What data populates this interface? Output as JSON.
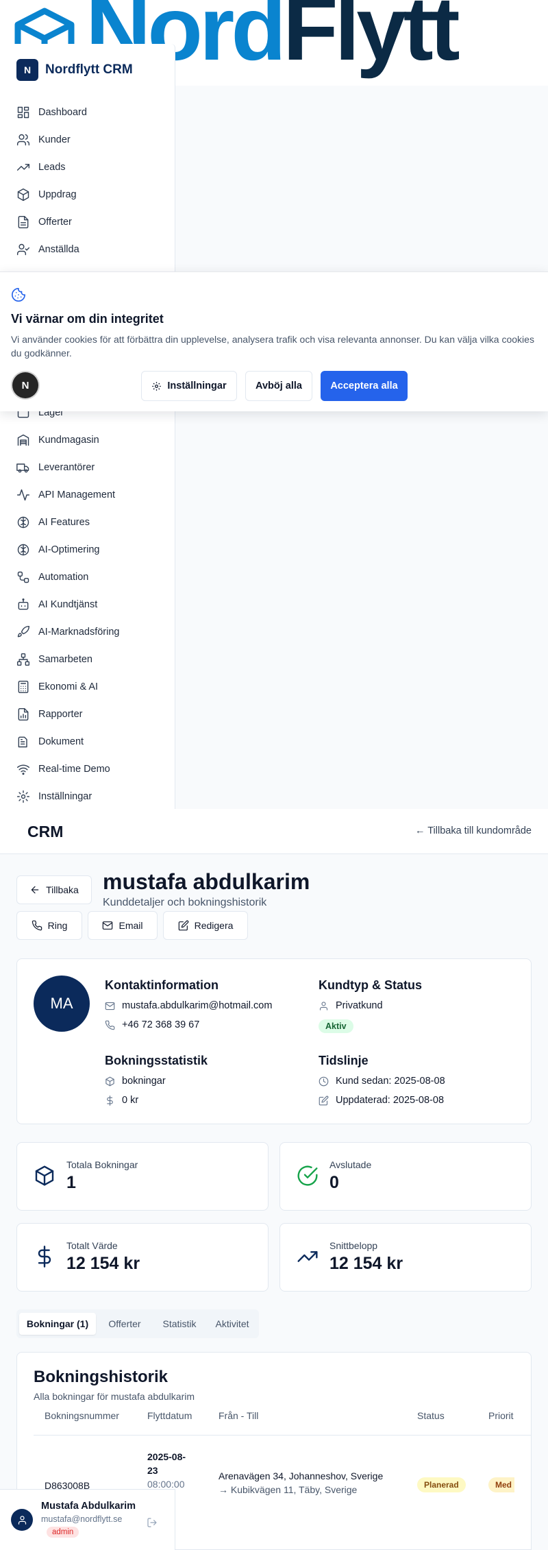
{
  "logo": {
    "part1": "Nord",
    "part2": "Flytt"
  },
  "brand": {
    "badge": "N",
    "name": "Nordflytt CRM"
  },
  "sidebar": {
    "top_items": [
      {
        "label": "Dashboard",
        "icon": "dashboard-icon"
      },
      {
        "label": "Kunder",
        "icon": "users-icon"
      },
      {
        "label": "Leads",
        "icon": "trending-up-icon"
      },
      {
        "label": "Uppdrag",
        "icon": "package-icon"
      },
      {
        "label": "Offerter",
        "icon": "file-text-icon"
      },
      {
        "label": "Anställda",
        "icon": "user-check-icon"
      }
    ],
    "bottom_items": [
      {
        "label": "Lager",
        "icon": "box-icon"
      },
      {
        "label": "Kundmagasin",
        "icon": "warehouse-icon"
      },
      {
        "label": "Leverantörer",
        "icon": "truck-icon"
      },
      {
        "label": "API Management",
        "icon": "activity-icon"
      },
      {
        "label": "AI Features",
        "icon": "brain-icon"
      },
      {
        "label": "AI-Optimering",
        "icon": "brain-icon"
      },
      {
        "label": "Automation",
        "icon": "workflow-icon"
      },
      {
        "label": "AI Kundtjänst",
        "icon": "bot-icon"
      },
      {
        "label": "AI-Marknadsföring",
        "icon": "rocket-icon"
      },
      {
        "label": "Samarbeten",
        "icon": "network-icon"
      },
      {
        "label": "Ekonomi & AI",
        "icon": "calculator-icon"
      },
      {
        "label": "Rapporter",
        "icon": "file-chart-icon"
      },
      {
        "label": "Dokument",
        "icon": "documents-icon"
      },
      {
        "label": "Real-time Demo",
        "icon": "wifi-icon"
      },
      {
        "label": "Inställningar",
        "icon": "settings-icon"
      }
    ]
  },
  "cookie": {
    "title": "Vi värnar om din integritet",
    "text": "Vi använder cookies för att förbättra din upplevelse, analysera trafik och visa relevanta annonser. Du kan välja vilka cookies du godkänner.",
    "avatar": "N",
    "settings_label": "Inställningar",
    "reject_label": "Avböj alla",
    "accept_label": "Acceptera alla"
  },
  "header": {
    "title": "CRM",
    "back_link": "← Tillbaka till kundområde"
  },
  "customer": {
    "back_label": "Tillbaka",
    "name": "mustafa abdulkarim",
    "subtitle": "Kunddetaljer och bokningshistorik",
    "actions": {
      "call": "Ring",
      "email": "Email",
      "edit": "Redigera"
    },
    "initials": "MA",
    "contact_title": "Kontaktinformation",
    "email": "mustafa.abdulkarim@hotmail.com",
    "phone": "+46 72 368 39 67",
    "type_title": "Kundtyp & Status",
    "type": "Privatkund",
    "status": "Aktiv",
    "stats_title": "Bokningsstatistik",
    "stats_bookings": "bokningar",
    "stats_value": "0 kr",
    "timeline_title": "Tidslinje",
    "since": "Kund sedan: 2025-08-08",
    "updated": "Uppdaterad: 2025-08-08"
  },
  "stats": [
    {
      "label": "Totala Bokningar",
      "value": "1",
      "icon": "package-icon"
    },
    {
      "label": "Avslutade",
      "value": "0",
      "icon": "check-circle-icon"
    },
    {
      "label": "Totalt Värde",
      "value": "12 154 kr",
      "icon": "dollar-icon"
    },
    {
      "label": "Snittbelopp",
      "value": "12 154 kr",
      "icon": "trending-up-icon"
    }
  ],
  "tabs": [
    "Bokningar (1)",
    "Offerter",
    "Statistik",
    "Aktivitet"
  ],
  "bookings": {
    "title": "Bokningshistorik",
    "subtitle": "Alla bokningar för mustafa abdulkarim",
    "columns": [
      "Bokningsnummer",
      "Flyttdatum",
      "Från - Till",
      "Status",
      "Priorit"
    ],
    "rows": [
      {
        "number": "D863008B",
        "date_line1": "2025-08-",
        "date_line2": "23",
        "time": "08:00:00",
        "from": "Arenavägen 34, Johanneshov, Sverige",
        "to": "→ Kubikvägen 11, Täby, Sverige",
        "status": "Planerad",
        "priority": "Med"
      }
    ]
  },
  "user": {
    "name": "Mustafa Abdulkarim",
    "email": "mustafa@nordflytt.se",
    "role": "admin"
  },
  "colors": {
    "primary": "#2563eb",
    "brand": "#0b2a5b",
    "logo_blue": "#0a84cf",
    "logo_dark": "#0b2a45"
  }
}
